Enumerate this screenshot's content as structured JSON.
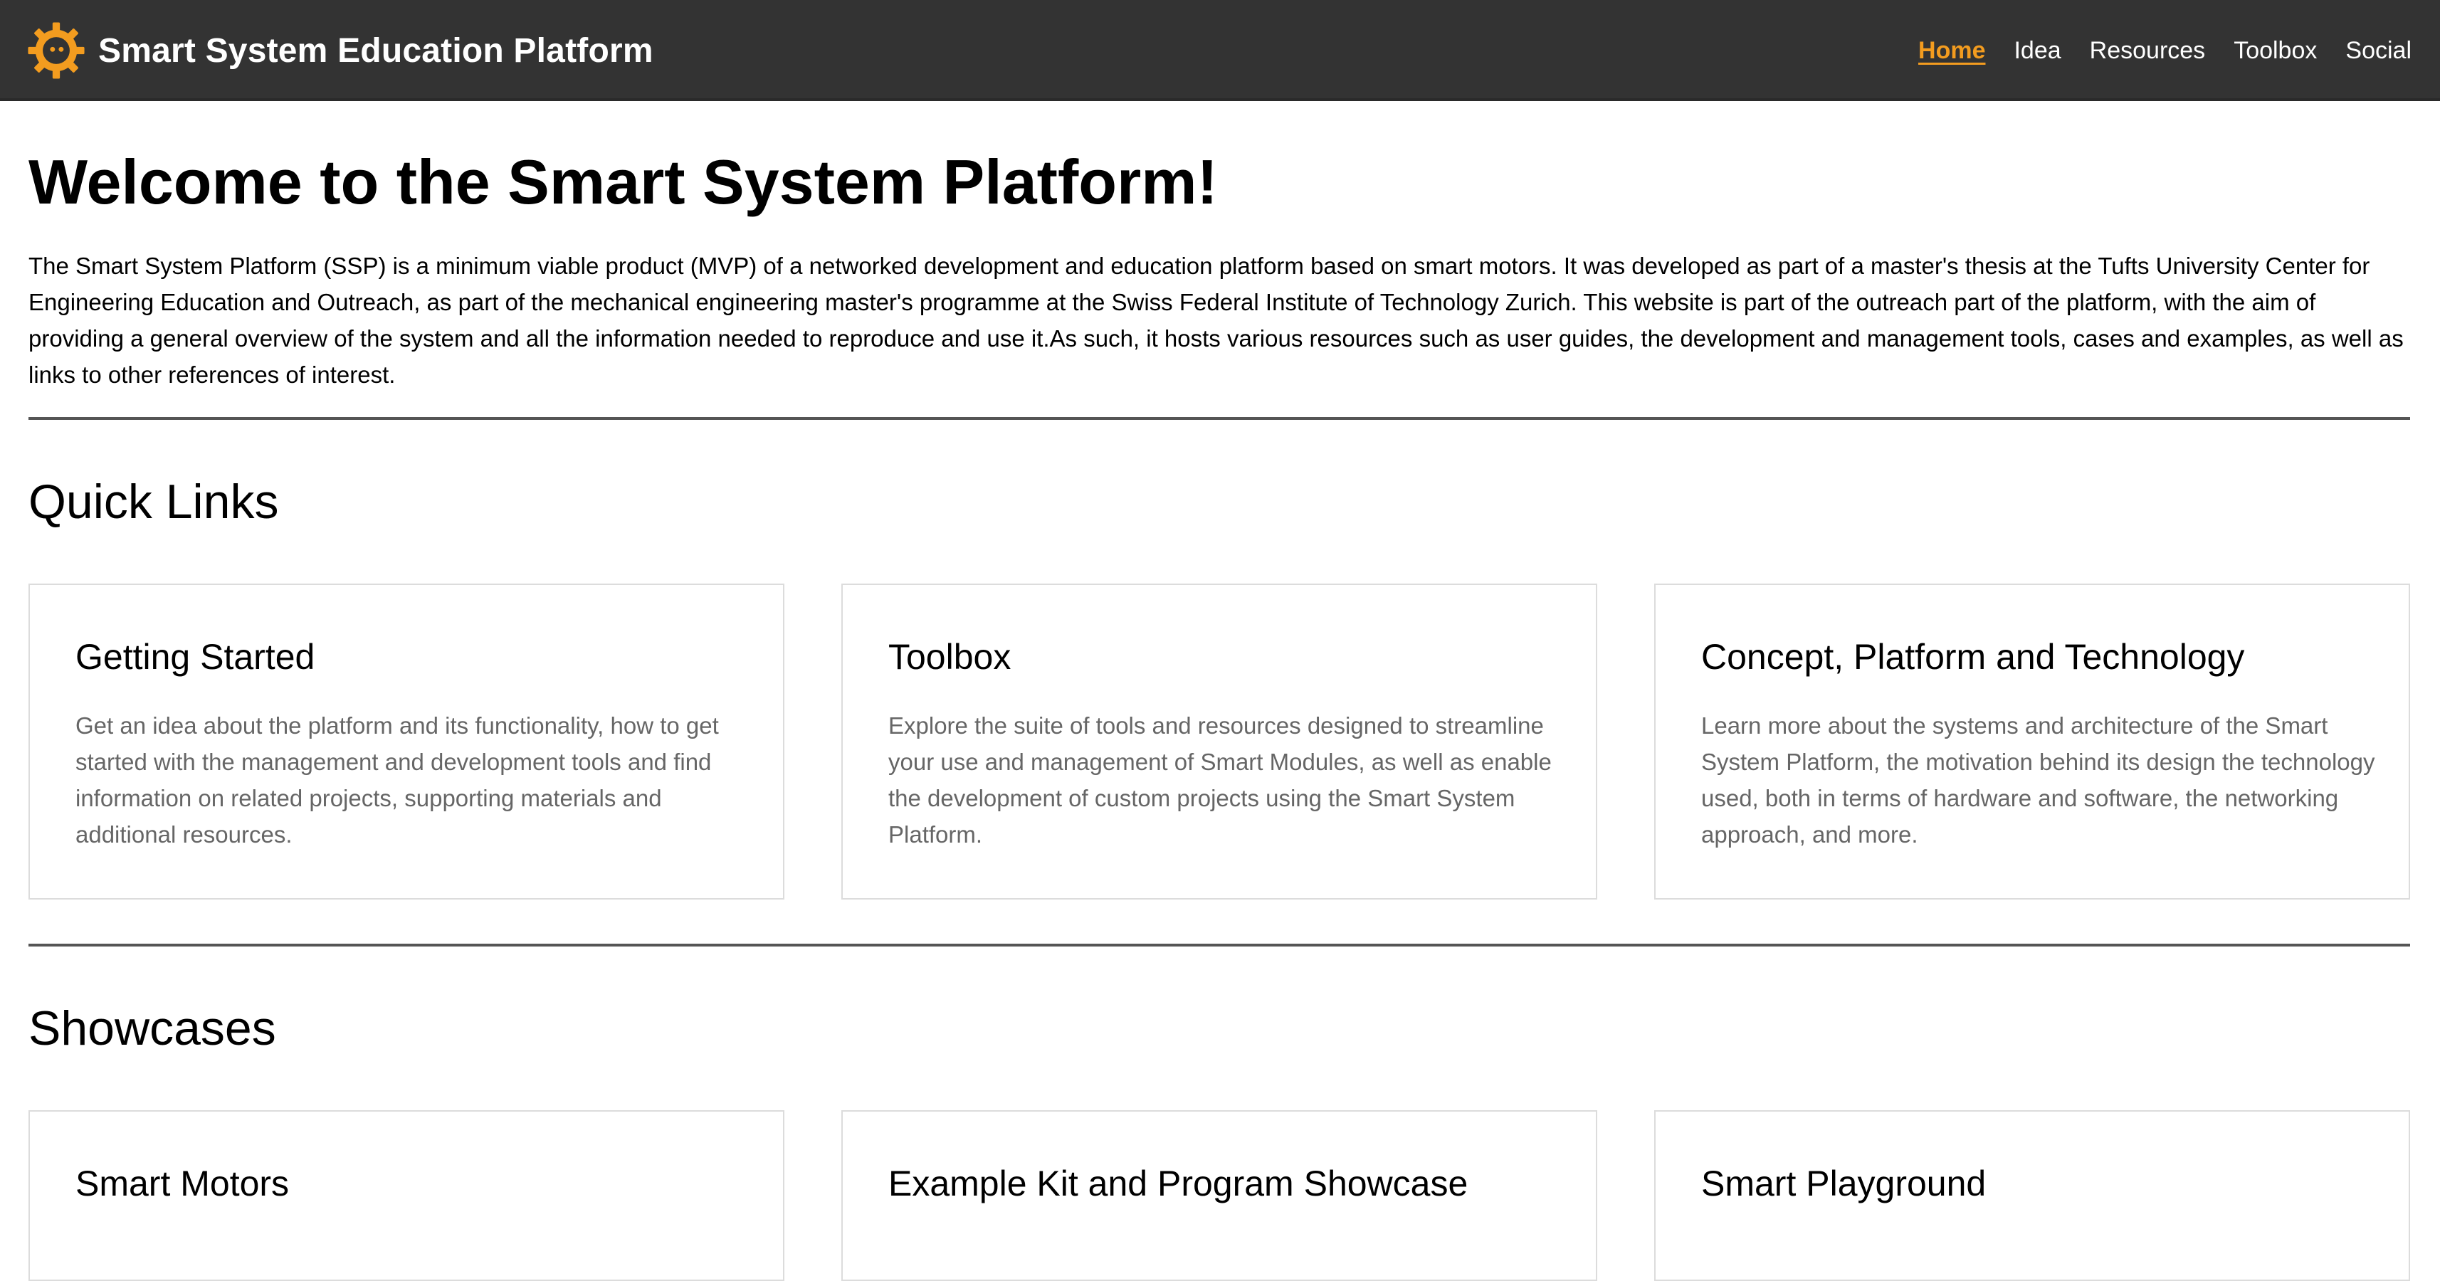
{
  "header": {
    "brand_title": "Smart System Education Platform",
    "nav": [
      {
        "label": "Home",
        "active": true
      },
      {
        "label": "Idea",
        "active": false
      },
      {
        "label": "Resources",
        "active": false
      },
      {
        "label": "Toolbox",
        "active": false
      },
      {
        "label": "Social",
        "active": false
      }
    ]
  },
  "main": {
    "title": "Welcome to the Smart System Platform!",
    "intro": "The Smart System Platform (SSP) is a minimum viable product (MVP) of a networked development and education platform based on smart motors. It was developed as part of a master's thesis at the Tufts University Center for Engineering Education and Outreach, as part of the mechanical engineering master's programme at the Swiss Federal Institute of Technology Zurich. This website is part of the outreach part of the platform, with the aim of providing a general overview of the system and all the information needed to reproduce and use it.As such, it hosts various resources such as user guides, the development and management tools, cases and examples, as well as links to other references of interest.",
    "quick_links": {
      "heading": "Quick Links",
      "cards": [
        {
          "title": "Getting Started",
          "text": "Get an idea about the platform and its functionality, how to get started with the management and development tools and find information on related projects, supporting materials and additional resources."
        },
        {
          "title": "Toolbox",
          "text": "Explore the suite of tools and resources designed to streamline your use and management of Smart Modules, as well as enable the development of custom projects using the Smart System Platform."
        },
        {
          "title": "Concept, Platform and Technology",
          "text": "Learn more about the systems and architecture of the Smart System Platform, the motivation behind its design the technology used, both in terms of hardware and software, the networking approach, and more."
        }
      ]
    },
    "showcases": {
      "heading": "Showcases",
      "cards": [
        {
          "title": "Smart Motors"
        },
        {
          "title": "Example Kit and Program Showcase"
        },
        {
          "title": "Smart Playground"
        }
      ]
    }
  },
  "colors": {
    "header_bg": "#333333",
    "accent": "#f39c1f",
    "card_text": "#666666"
  },
  "icons": {
    "logo": "gear-logo-icon"
  }
}
